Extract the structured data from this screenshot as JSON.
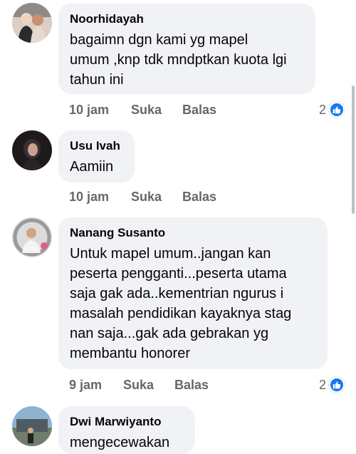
{
  "comments": [
    {
      "author": "Noorhidayah",
      "text": "bagaimn dgn kami yg mapel\numum ,knp tdk mndptkan kuota lgi\ntahun ini",
      "time": "10 jam",
      "like": "Suka",
      "reply": "Balas",
      "reactions": "2"
    },
    {
      "author": "Usu Ivah",
      "text": "Aamiin",
      "time": "10 jam",
      "like": "Suka",
      "reply": "Balas"
    },
    {
      "author": "Nanang Susanto",
      "text": "Untuk mapel umum..jangan kan\npeserta pengganti...peserta utama\nsaja gak ada..kementrian ngurus i\nmasalah pendidikan kayaknya stag\nnan saja...gak ada gebrakan yg\nmembantu honorer",
      "time": "9 jam",
      "like": "Suka",
      "reply": "Balas",
      "reactions": "2"
    },
    {
      "author": "Dwi Marwiyanto",
      "text": "mengecewakan"
    }
  ],
  "icons": {
    "like_badge": "thumbs-up-icon"
  },
  "colors": {
    "bubble": "#f0f2f5",
    "meta": "#65676b",
    "like_blue": "#1877f2"
  }
}
